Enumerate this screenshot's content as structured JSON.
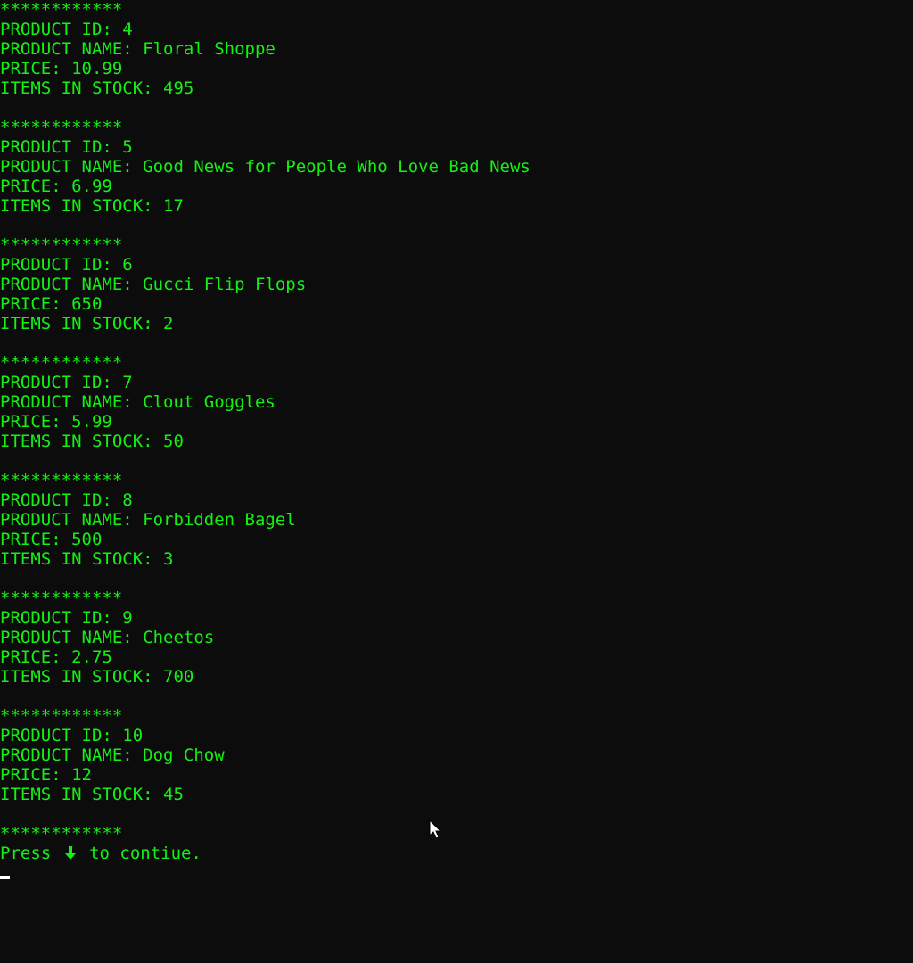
{
  "separator": "************",
  "labels": {
    "id": "PRODUCT ID: ",
    "name": "PRODUCT NAME: ",
    "price": "PRICE: ",
    "stock": "ITEMS IN STOCK: "
  },
  "products": [
    {
      "id": "4",
      "name": "Floral Shoppe",
      "price": "10.99",
      "stock": "495"
    },
    {
      "id": "5",
      "name": "Good News for People Who Love Bad News",
      "price": "6.99",
      "stock": "17"
    },
    {
      "id": "6",
      "name": "Gucci Flip Flops",
      "price": "650",
      "stock": "2"
    },
    {
      "id": "7",
      "name": "Clout Goggles",
      "price": "5.99",
      "stock": "50"
    },
    {
      "id": "8",
      "name": "Forbidden Bagel",
      "price": "500",
      "stock": "3"
    },
    {
      "id": "9",
      "name": "Cheetos",
      "price": "2.75",
      "stock": "700"
    },
    {
      "id": "10",
      "name": "Dog Chow",
      "price": "12",
      "stock": "45"
    }
  ],
  "prompt": {
    "before": "Press ",
    "icon": "down-arrow-icon",
    "after": " to contiue."
  },
  "colors": {
    "background": "#0c0c0c",
    "text": "#14f014",
    "cursor": "#ffffff"
  }
}
